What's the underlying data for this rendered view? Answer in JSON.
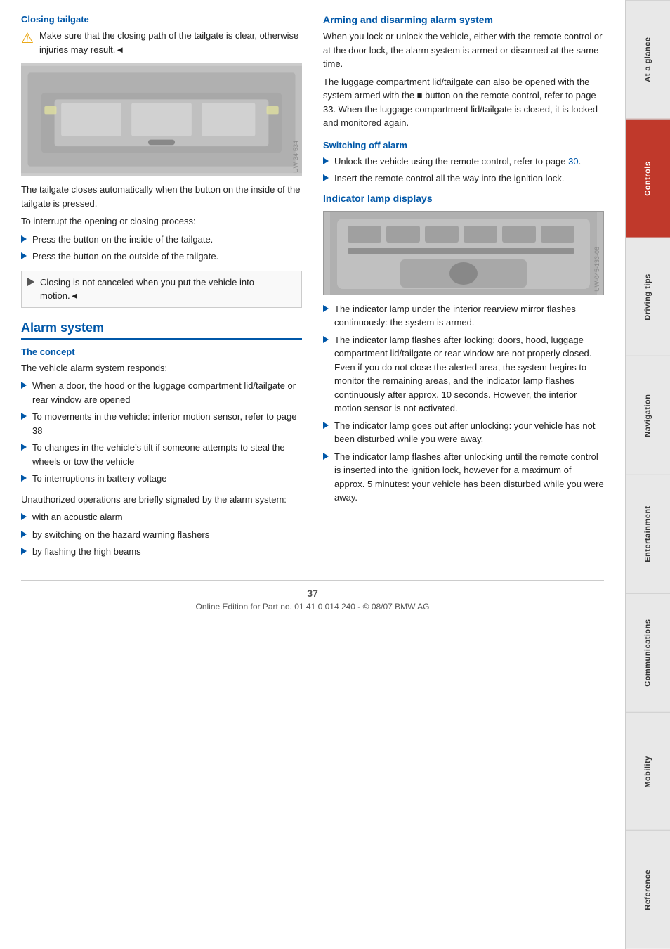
{
  "page": {
    "number": "37",
    "footer_text": "Online Edition for Part no. 01 41 0 014 240 - © 08/07 BMW AG"
  },
  "side_tabs": [
    {
      "id": "at-a-glance",
      "label": "At a glance",
      "active": false
    },
    {
      "id": "controls",
      "label": "Controls",
      "active": true
    },
    {
      "id": "driving-tips",
      "label": "Driving tips",
      "active": false
    },
    {
      "id": "navigation",
      "label": "Navigation",
      "active": false
    },
    {
      "id": "entertainment",
      "label": "Entertainment",
      "active": false
    },
    {
      "id": "communications",
      "label": "Communications",
      "active": false
    },
    {
      "id": "mobility",
      "label": "Mobility",
      "active": false
    },
    {
      "id": "reference",
      "label": "Reference",
      "active": false
    }
  ],
  "left_column": {
    "closing_tailgate": {
      "title": "Closing tailgate",
      "warning_text": "Make sure that the closing path of the tailgate is clear, otherwise injuries may result.◄",
      "body_text": "The tailgate closes automatically when the button on the inside of the tailgate is pressed.",
      "interrupt_intro": "To interrupt the opening or closing process:",
      "interrupt_list": [
        "Press the button on the inside of the tailgate.",
        "Press the button on the outside of the tailgate."
      ],
      "note_text": "Closing is not canceled when you put the vehicle into motion.◄"
    },
    "alarm_system": {
      "title": "Alarm system",
      "concept": {
        "title": "The concept",
        "intro": "The vehicle alarm system responds:",
        "items": [
          "When a door, the hood or the luggage compartment lid/tailgate or rear window are opened",
          "To movements in the vehicle: interior motion sensor, refer to page 38",
          "To changes in the vehicle’s tilt if someone attempts to steal the wheels or tow the vehicle",
          "To interruptions in battery voltage"
        ],
        "unauthorized_intro": "Unauthorized operations are briefly signaled by the alarm system:",
        "unauthorized_items": [
          "with an acoustic alarm",
          "by switching on the hazard warning flashers",
          "by flashing the high beams"
        ]
      }
    }
  },
  "right_column": {
    "arming_disarming": {
      "title": "Arming and disarming alarm system",
      "para1": "When you lock or unlock the vehicle, either with the remote control or at the door lock, the alarm system is armed or disarmed at the same time.",
      "para2": "The luggage compartment lid/tailgate can also be opened with the system armed with the ■ button on the remote control, refer to page 33. When the luggage compartment lid/tailgate is closed, it is locked and monitored again."
    },
    "switching_off_alarm": {
      "title": "Switching off alarm",
      "items": [
        "Unlock the vehicle using the remote control, refer to page 30.",
        "Insert the remote control all the way into the ignition lock."
      ],
      "link_page_30": "30"
    },
    "indicator_lamp": {
      "title": "Indicator lamp displays",
      "items": [
        "The indicator lamp under the interior rearview mirror flashes continuously: the system is armed.",
        "The indicator lamp flashes after locking: doors, hood, luggage compartment lid/tailgate or rear window are not properly closed. Even if you do not close the alerted area, the system begins to monitor the remaining areas, and the indicator lamp flashes continuously after approx. 10 seconds. However, the interior motion sensor is not activated.",
        "The indicator lamp goes out after unlocking: your vehicle has not been disturbed while you were away.",
        "The indicator lamp flashes after unlocking until the remote control is inserted into the ignition lock, however for a maximum of approx. 5 minutes: your vehicle has been disturbed while you were away."
      ]
    }
  }
}
